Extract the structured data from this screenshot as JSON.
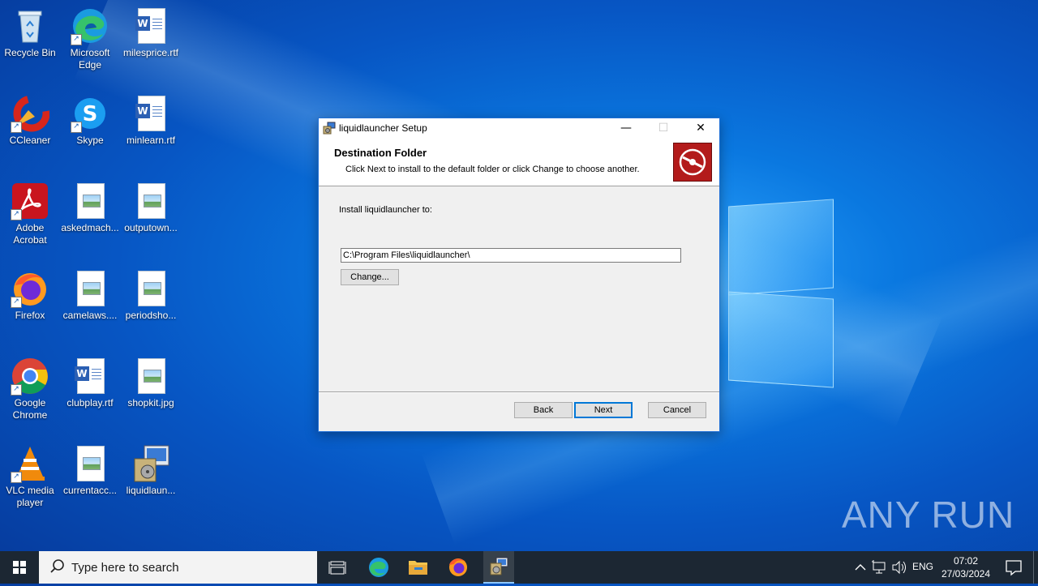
{
  "desktop": {
    "icons": [
      {
        "label": "Recycle Bin"
      },
      {
        "label": "Microsoft Edge"
      },
      {
        "label": "milesprice.rtf"
      },
      {
        "label": "CCleaner"
      },
      {
        "label": "Skype"
      },
      {
        "label": "minlearn.rtf"
      },
      {
        "label": "Adobe Acrobat"
      },
      {
        "label": "askedmach..."
      },
      {
        "label": "outputown..."
      },
      {
        "label": "Firefox"
      },
      {
        "label": "camelaws...."
      },
      {
        "label": "periodsho..."
      },
      {
        "label": "Google Chrome"
      },
      {
        "label": "clubplay.rtf"
      },
      {
        "label": "shopkit.jpg"
      },
      {
        "label": "VLC media player"
      },
      {
        "label": "currentacc..."
      },
      {
        "label": "liquidlaun..."
      }
    ]
  },
  "dialog": {
    "title": "liquidlauncher Setup",
    "heading": "Destination Folder",
    "subheading": "Click Next to install to the default folder or click Change to choose another.",
    "install_label": "Install liquidlauncher to:",
    "path": "C:\\Program Files\\liquidlauncher\\",
    "change_label": "Change...",
    "back_label": "Back",
    "next_label": "Next",
    "cancel_label": "Cancel"
  },
  "taskbar": {
    "search_placeholder": "Type here to search",
    "language": "ENG",
    "time": "07:02",
    "date": "27/03/2024"
  },
  "watermark": "ANY RUN",
  "colors": {
    "accent": "#0078d7",
    "banner_logo": "#b31b1b",
    "taskbar": "#1c2733"
  }
}
